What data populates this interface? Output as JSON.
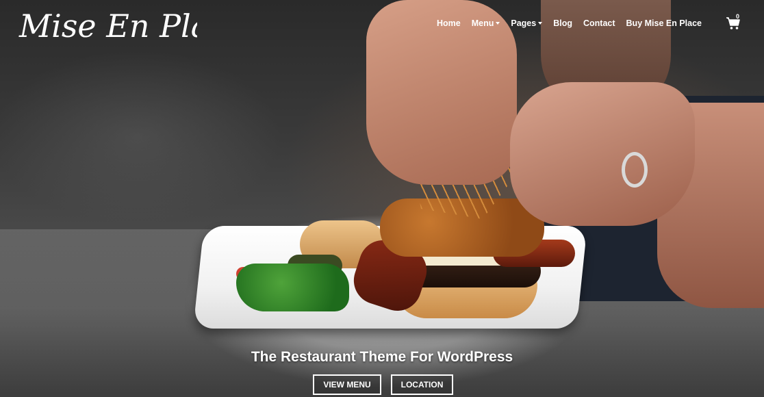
{
  "brand": {
    "logo_text": "Mise En Place"
  },
  "nav": {
    "items": [
      {
        "label": "Home",
        "has_dropdown": false
      },
      {
        "label": "Menu",
        "has_dropdown": true
      },
      {
        "label": "Pages",
        "has_dropdown": true
      },
      {
        "label": "Blog",
        "has_dropdown": false
      },
      {
        "label": "Contact",
        "has_dropdown": false
      },
      {
        "label": "Buy Mise En Place",
        "has_dropdown": false
      }
    ],
    "cart_icon": "cart-icon",
    "cart_count": "0"
  },
  "hero": {
    "tagline": "The Restaurant Theme For WordPress",
    "buttons": {
      "view_menu": "VIEW MENU",
      "location": "LOCATION"
    }
  },
  "colors": {
    "text": "#ffffff",
    "background": "#2a2a2a"
  }
}
